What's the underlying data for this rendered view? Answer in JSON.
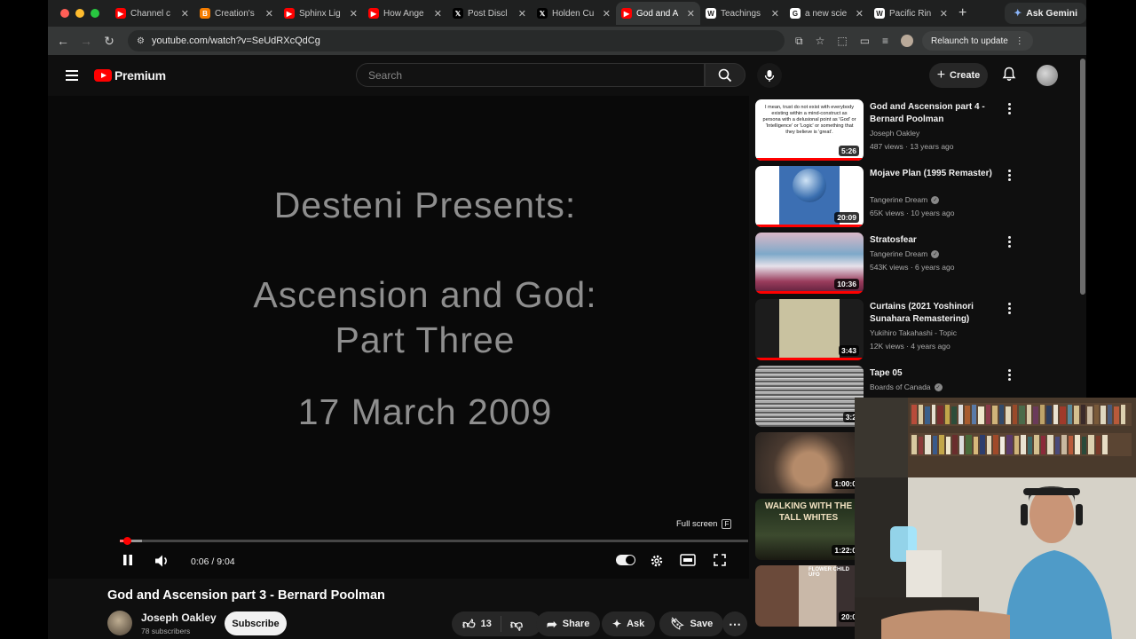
{
  "browser": {
    "tabs": [
      {
        "label": "Channel c",
        "favicon": "youtube",
        "active": false
      },
      {
        "label": "Creation's",
        "favicon": "blogger",
        "active": false
      },
      {
        "label": "Sphinx Lig",
        "favicon": "youtube",
        "active": false
      },
      {
        "label": "How Ange",
        "favicon": "youtube",
        "active": false
      },
      {
        "label": "Post Discl",
        "favicon": "x",
        "active": false
      },
      {
        "label": "Holden Cu",
        "favicon": "x",
        "active": false
      },
      {
        "label": "God and A",
        "favicon": "youtube",
        "active": true
      },
      {
        "label": "Teachings",
        "favicon": "wikipedia",
        "active": false
      },
      {
        "label": "a new scie",
        "favicon": "google",
        "active": false
      },
      {
        "label": "Pacific Rin",
        "favicon": "wikipedia",
        "active": false
      }
    ],
    "gemini_label": "Ask Gemini",
    "url": "youtube.com/watch?v=SeUdRXcQdCg",
    "relaunch_label": "Relaunch to update"
  },
  "masthead": {
    "logo_text": "Premium",
    "search_placeholder": "Search",
    "create_label": "Create"
  },
  "player": {
    "slide_lines": [
      "Desteni Presents:",
      "Ascension and God:",
      "Part Three",
      "17 March 2009"
    ],
    "fullscreen_tip": "Full screen",
    "fullscreen_key": "F",
    "time": "0:06 / 9:04",
    "progress_fraction": 0.011
  },
  "video": {
    "title": "God and Ascension part 3 - Bernard Poolman",
    "channel": "Joseph Oakley",
    "subscribers": "78 subscribers",
    "subscribe_label": "Subscribe",
    "likes": "13",
    "share_label": "Share",
    "ask_label": "Ask",
    "save_label": "Save"
  },
  "recommendations": [
    {
      "title": "God and Ascension part 4 - Bernard Poolman",
      "channel": "Joseph Oakley",
      "verified": false,
      "meta": "487 views · 13 years ago",
      "duration": "5:26",
      "watched": true,
      "thumb_text": "I mean, trust do not exist with everybody existing within a mind-construct as persona with a delusional point as 'God' or 'Intelligence' or 'Logic' or something that they believe is 'great'."
    },
    {
      "title": "Mojave Plan (1995 Remaster)",
      "channel": "Tangerine Dream",
      "verified": true,
      "meta": "65K views · 10 years ago",
      "duration": "20:09",
      "watched": true
    },
    {
      "title": "Stratosfear",
      "channel": "Tangerine Dream",
      "verified": true,
      "meta": "543K views · 6 years ago",
      "duration": "10:36",
      "watched": true
    },
    {
      "title": "Curtains (2021 Yoshinori Sunahara Remastering)",
      "channel": "Yukihiro Takahashi - Topic",
      "verified": false,
      "meta": "12K views · 4 years ago",
      "duration": "3:43",
      "watched": true
    },
    {
      "title": "Tape 05",
      "channel": "Boards of Canada",
      "verified": true,
      "meta": "",
      "duration": "3:2",
      "watched": false
    },
    {
      "title": "",
      "channel": "",
      "verified": false,
      "meta": "",
      "duration": "1:00:0",
      "watched": false
    },
    {
      "title": "",
      "channel": "",
      "verified": false,
      "meta": "",
      "duration": "1:22:0",
      "watched": false,
      "thumb_text": "WALKING WITH THE TALL WHITES"
    },
    {
      "title": "",
      "channel": "",
      "verified": false,
      "meta": "",
      "duration": "20:0",
      "watched": false,
      "thumb_text": "FLOWER CHILD UFO"
    }
  ],
  "colors": {
    "youtube_red": "#ff0000",
    "background": "#0f0f0f"
  }
}
